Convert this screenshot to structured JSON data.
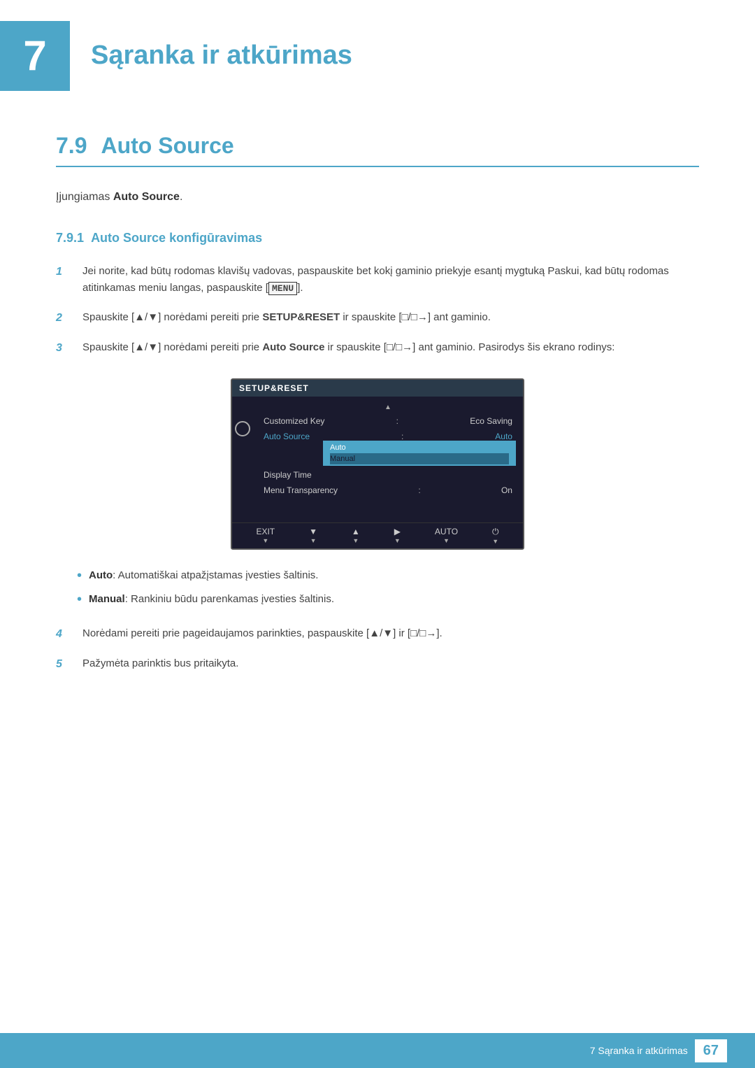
{
  "header": {
    "chapter_number": "7",
    "chapter_title": "Sąranka ir atkūrimas",
    "diagonal_pattern_color": "#c8e6f0",
    "accent_color": "#4da6c8"
  },
  "section": {
    "number": "7.9",
    "title": "Auto Source"
  },
  "intro": {
    "text_before": "Įjungiamas ",
    "bold_text": "Auto Source",
    "text_after": "."
  },
  "subsection": {
    "number": "7.9.1",
    "title": "Auto Source konfigūravimas"
  },
  "steps": [
    {
      "number": "1",
      "text": "Jei norite, kad būtų rodomas klavišų vadovas, paspauskite bet kokį gaminio priekyje esantį mygtuką Paskui, kad būtų rodomas atitinkamas meniu langas, paspauskite [MENU]."
    },
    {
      "number": "2",
      "text": "Spauskite [▲/▼] norėdami pereiti prie SETUP&RESET ir spauskite [□/□→] ant gaminio."
    },
    {
      "number": "3",
      "text": "Spauskite [▲/▼] norėdami pereiti prie Auto Source ir spauskite [□/□→] ant gaminio. Pasirodys šis ekrano rodinys:"
    },
    {
      "number": "4",
      "text": "Norėdami pereiti prie pageidaujamos parinkties, paspauskite [▲/▼] ir [□/□→]."
    },
    {
      "number": "5",
      "text": "Pažymėta parinktis bus pritaikyta."
    }
  ],
  "monitor": {
    "menu_title": "SETUP&RESET",
    "up_arrow": "▲",
    "menu_items": [
      {
        "label": "Customized Key",
        "separator": ":",
        "value": "Eco Saving"
      },
      {
        "label": "Auto Source",
        "separator": ":",
        "value": "Auto",
        "highlighted": true
      },
      {
        "label": "Display Time",
        "separator": "",
        "value": ""
      },
      {
        "label": "Menu Transparency",
        "separator": ":",
        "value": "On"
      }
    ],
    "submenu_items": [
      {
        "label": "Auto",
        "active": true
      },
      {
        "label": "Manual",
        "active": false
      }
    ],
    "bottom_buttons": [
      {
        "icon": "EXIT",
        "label": "▼"
      },
      {
        "icon": "▼",
        "label": "▼"
      },
      {
        "icon": "▲",
        "label": "▼"
      },
      {
        "icon": "▶",
        "label": "▼"
      },
      {
        "icon": "AUTO",
        "label": "▼"
      },
      {
        "icon": "⏻",
        "label": "▼"
      }
    ]
  },
  "bullets": [
    {
      "bold": "Auto",
      "text": ": Automatiškai atpažįstamas įvesties šaltinis."
    },
    {
      "bold": "Manual",
      "text": ": Rankiniu būdu parenkamas įvesties šaltinis."
    }
  ],
  "footer": {
    "chapter_ref": "7 Sąranka ir atkūrimas",
    "page_number": "67"
  }
}
